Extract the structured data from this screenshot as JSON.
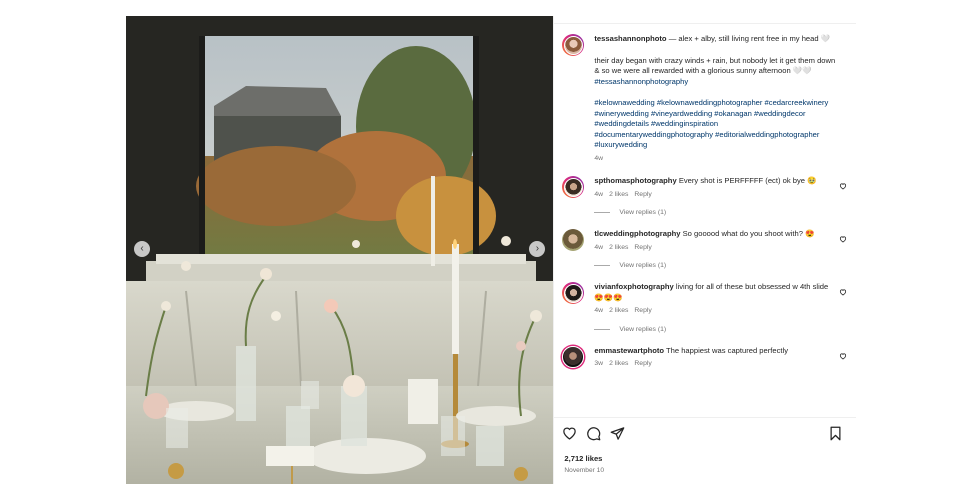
{
  "post": {
    "media": {
      "prev_glyph": "‹",
      "next_glyph": "›"
    },
    "caption": {
      "username": "tessashannonphoto",
      "line1": "— alex + alby, still living rent free in my head 🤍",
      "line2": "their day began with crazy winds + rain, but nobody let it get them down & so we were all rewarded with a glorious sunny afternoon 🤍🤍",
      "tag_inline": "#tessashannonphotography",
      "hashtags": "#kelownawedding #kelownaweddingphotographer #cedarcreekwinery #winerywedding #vineyardwedding #okanagan #weddingdecor #weddingdetails #weddinginspiration #documentaryweddingphotography #editorialweddingphotographer #luxurywedding",
      "time": "4w"
    },
    "comments": [
      {
        "username": "spthomasphotography",
        "text": "Every shot is PERFFFFF (ect) ok bye 🥹",
        "time": "4w",
        "likes": "2 likes",
        "reply": "Reply",
        "view_replies": "View replies (1)"
      },
      {
        "username": "tlcweddingphotography",
        "text": "So gooood what do you shoot with? 😍",
        "time": "4w",
        "likes": "2 likes",
        "reply": "Reply",
        "view_replies": "View replies (1)"
      },
      {
        "username": "vivianfoxphotography",
        "text": "living for all of these but obsessed w 4th slide 😍😍😍",
        "time": "4w",
        "likes": "2 likes",
        "reply": "Reply",
        "view_replies": "View replies (1)"
      },
      {
        "username": "emmastewartphoto",
        "text": "The happiest was captured perfectly",
        "time": "3w",
        "likes": "2 likes",
        "reply": "Reply"
      }
    ],
    "likes_count": "2,712 likes",
    "date": "November 10"
  }
}
